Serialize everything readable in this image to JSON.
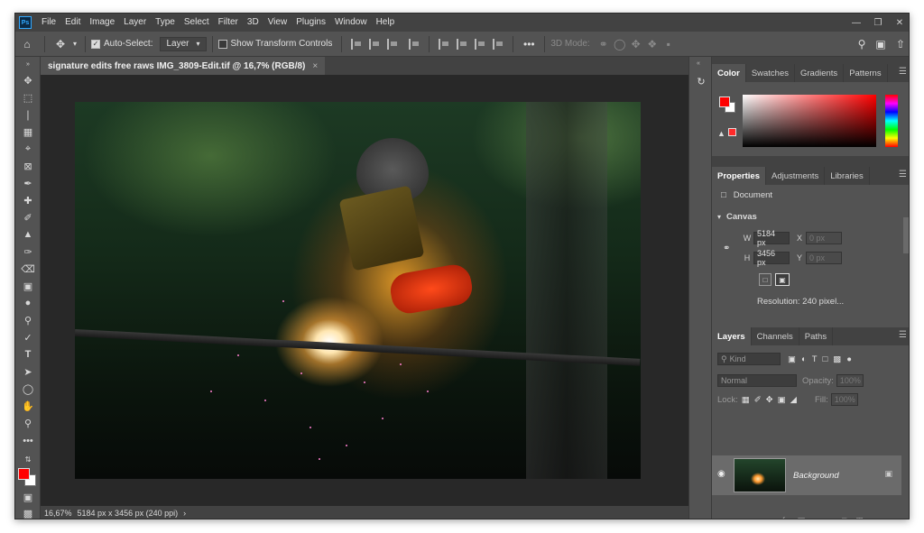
{
  "menubar": {
    "logo": "Ps",
    "items": [
      "File",
      "Edit",
      "Image",
      "Layer",
      "Type",
      "Select",
      "Filter",
      "3D",
      "View",
      "Plugins",
      "Window",
      "Help"
    ]
  },
  "options": {
    "auto_select_label": "Auto-Select:",
    "layer_dropdown": "Layer",
    "show_transform_label": "Show Transform Controls",
    "mode_3d_label": "3D Mode:"
  },
  "document": {
    "tab_title": "signature edits free raws IMG_3809-Edit.tif @ 16,7% (RGB/8)",
    "zoom": "16,67%",
    "info": "5184 px x 3456 px (240 ppi)"
  },
  "color_panel": {
    "tabs": [
      "Color",
      "Swatches",
      "Gradients",
      "Patterns"
    ],
    "fg_color": "#ff0000",
    "bg_color": "#ffffff"
  },
  "properties_panel": {
    "tabs": [
      "Properties",
      "Adjustments",
      "Libraries"
    ],
    "doc_label": "Document",
    "section": "Canvas",
    "w_label": "W",
    "w_value": "5184 px",
    "h_label": "H",
    "h_value": "3456 px",
    "x_label": "X",
    "x_placeholder": "0 px",
    "y_label": "Y",
    "y_placeholder": "0 px",
    "resolution": "Resolution: 240 pixel..."
  },
  "layers_panel": {
    "tabs": [
      "Layers",
      "Channels",
      "Paths"
    ],
    "kind_label": "Kind",
    "blend_mode": "Normal",
    "opacity_label": "Opacity:",
    "opacity_value": "100%",
    "lock_label": "Lock:",
    "fill_label": "Fill:",
    "fill_value": "100%",
    "layers": [
      {
        "name": "Background"
      }
    ],
    "footer_icons": [
      "link-icon",
      "fx-icon",
      "mask-icon",
      "adjustment-icon",
      "group-icon",
      "new-layer-icon",
      "trash-icon"
    ]
  },
  "toolbar": {
    "fg_color": "#ff0000",
    "bg_color": "#ffffff"
  }
}
